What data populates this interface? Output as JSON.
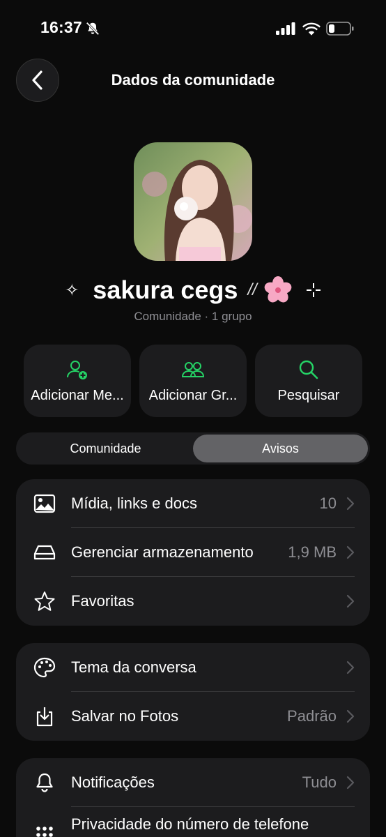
{
  "status": {
    "time": "16:37"
  },
  "header": {
    "title": "Dados da comunidade"
  },
  "profile": {
    "name": "sakura cegs",
    "slash_glyph": "//",
    "sparkle_left": "✧",
    "subtitle": "Comunidade · 1 grupo"
  },
  "actions": [
    {
      "label": "Adicionar Me...",
      "icon": "add-member-icon"
    },
    {
      "label": "Adicionar Gr...",
      "icon": "add-group-icon"
    },
    {
      "label": "Pesquisar",
      "icon": "search-icon"
    }
  ],
  "segments": {
    "left": "Comunidade",
    "right": "Avisos",
    "selected": "Avisos"
  },
  "group1": [
    {
      "label": "Mídia, links e docs",
      "value": "10",
      "icon": "photo-icon"
    },
    {
      "label": "Gerenciar armazenamento",
      "value": "1,9 MB",
      "icon": "storage-icon"
    },
    {
      "label": "Favoritas",
      "value": "",
      "icon": "star-icon"
    }
  ],
  "group2": [
    {
      "label": "Tema da conversa",
      "value": "",
      "icon": "palette-icon"
    },
    {
      "label": "Salvar no Fotos",
      "value": "Padrão",
      "icon": "save-icon"
    }
  ],
  "group3": [
    {
      "label": "Notificações",
      "value": "Tudo",
      "icon": "bell-icon"
    },
    {
      "label": "Privacidade do número de telefone",
      "value": "",
      "icon": "dots-grid-icon"
    }
  ],
  "colors": {
    "accent": "#25d366",
    "background": "#0b0b0b",
    "card": "#1c1c1e",
    "secondary_text": "#8e8e93"
  }
}
